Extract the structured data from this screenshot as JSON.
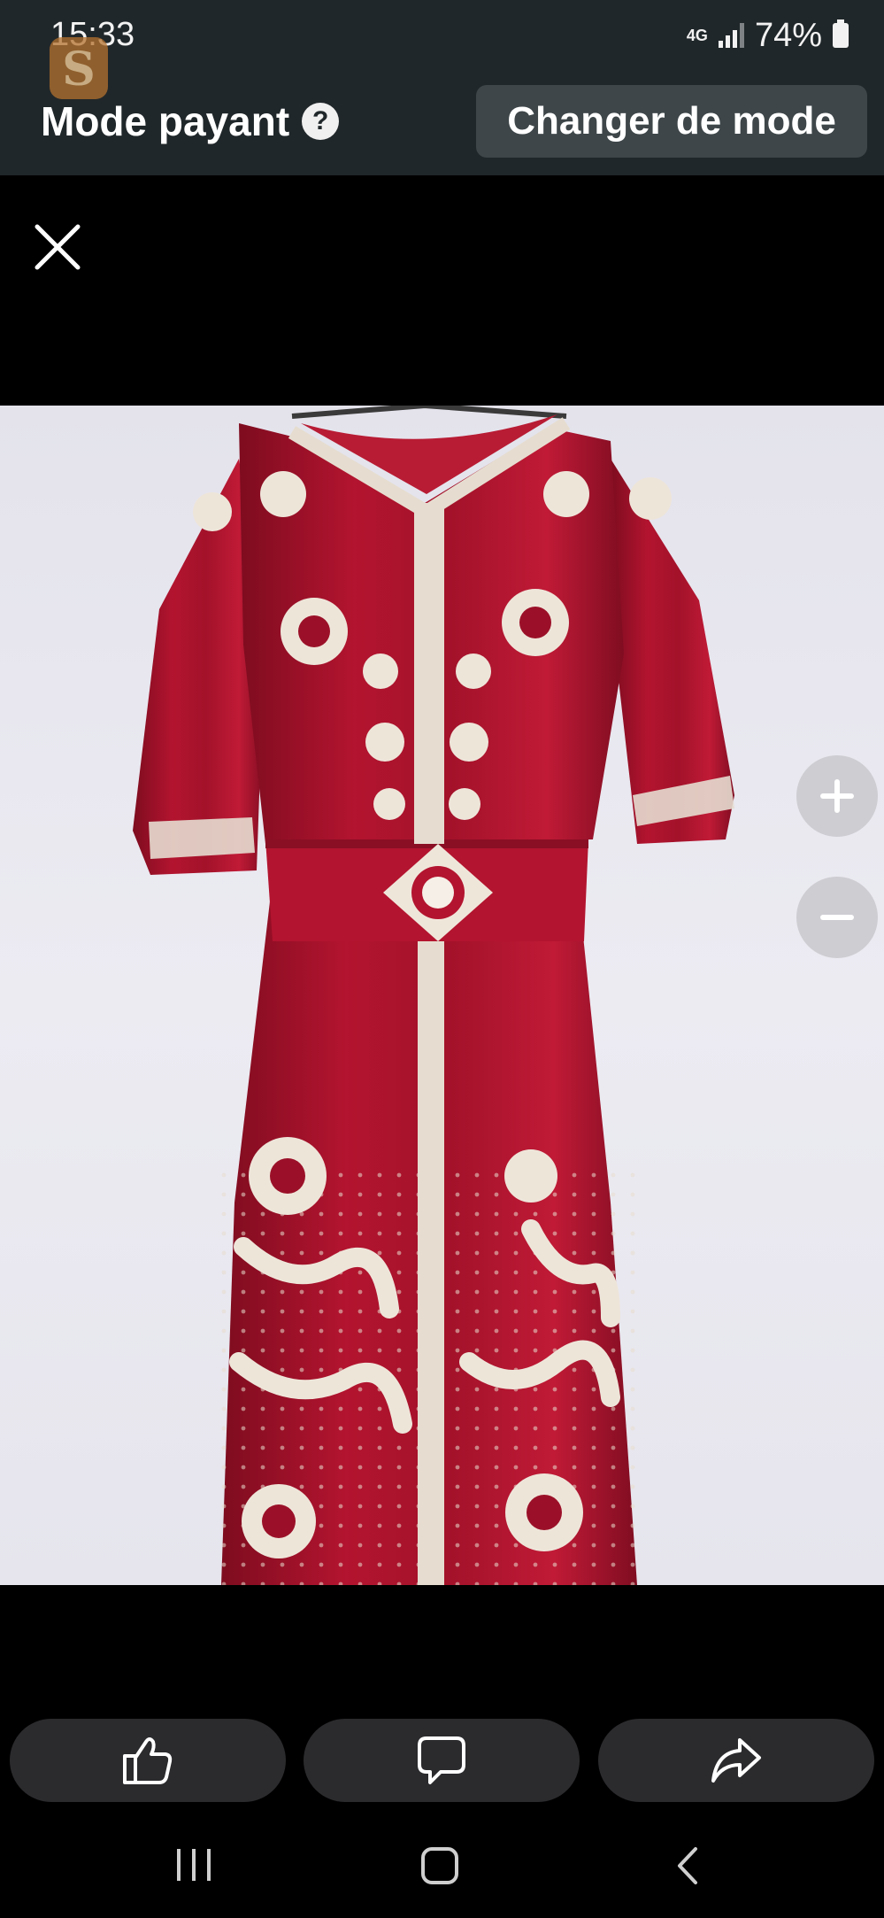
{
  "status_bar": {
    "time": "15:33",
    "network_type": "4G",
    "battery": "74%",
    "icons": [
      "signal-icon",
      "battery-icon"
    ]
  },
  "mode_bar": {
    "title": "Mode payant",
    "help_icon": "?",
    "change_mode_label": "Changer de mode"
  },
  "viewer": {
    "close_icon": "close-icon",
    "zoom_in_icon": "plus-icon",
    "zoom_out_icon": "minus-icon",
    "photo": "red velvet embroidered kaftan dress on hanger"
  },
  "actions": {
    "like_icon": "thumbs-up-icon",
    "comment_icon": "comment-icon",
    "share_icon": "share-icon"
  },
  "navigation": {
    "icons": [
      "recent-apps-icon",
      "home-icon",
      "back-icon"
    ]
  },
  "colors": {
    "top_bar": "#20272a",
    "button": "#3e4649",
    "dress_red": "#a3122a",
    "embroidery": "#e6ddd0",
    "action_button": "#2b2b2e"
  }
}
